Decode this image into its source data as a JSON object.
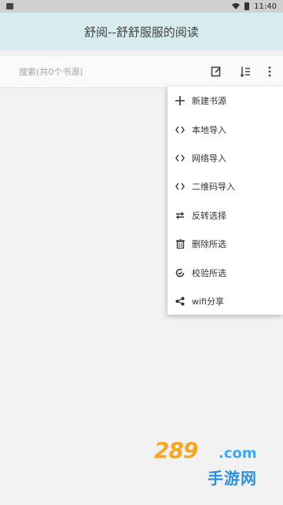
{
  "status_bar": {
    "time": "11:40"
  },
  "app_bar": {
    "title": "舒阅--舒舒服服的阅读"
  },
  "search": {
    "placeholder": "搜索(共0个书源)"
  },
  "menu": {
    "items": [
      {
        "label": "新建书源",
        "icon": "plus-icon"
      },
      {
        "label": "本地导入",
        "icon": "code-icon"
      },
      {
        "label": "网络导入",
        "icon": "code-icon"
      },
      {
        "label": "二维码导入",
        "icon": "code-icon"
      },
      {
        "label": "反转选择",
        "icon": "swap-icon"
      },
      {
        "label": "删除所选",
        "icon": "trash-icon"
      },
      {
        "label": "校验所选",
        "icon": "check-cycle-icon"
      },
      {
        "label": "wifi分享",
        "icon": "share-icon"
      }
    ]
  },
  "watermark": {
    "brand": "289",
    "domain": ".com",
    "sub": "手游网"
  },
  "colors": {
    "app_bar_bg": "#d7ecef",
    "accent": "#f5a623",
    "watermark_blue": "#2f8fdc"
  }
}
